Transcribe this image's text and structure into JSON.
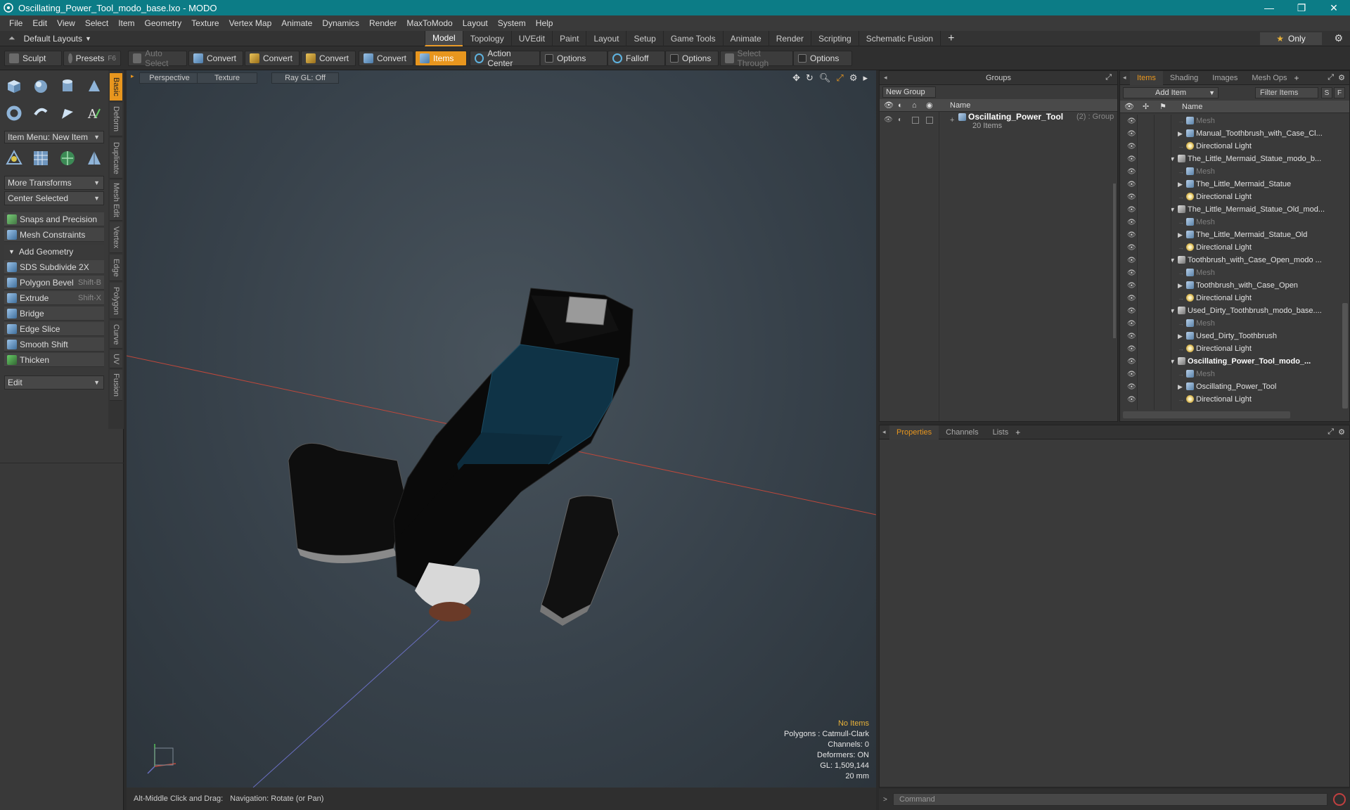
{
  "window": {
    "title": "Oscillating_Power_Tool_modo_base.lxo - MODO",
    "min": "—",
    "max": "❐",
    "close": "✕"
  },
  "menu": [
    "File",
    "Edit",
    "View",
    "Select",
    "Item",
    "Geometry",
    "Texture",
    "Vertex Map",
    "Animate",
    "Dynamics",
    "Render",
    "MaxToModo",
    "Layout",
    "System",
    "Help"
  ],
  "layoutbar": {
    "default_layouts": "Default Layouts",
    "tabs": [
      "Model",
      "Topology",
      "UVEdit",
      "Paint",
      "Layout",
      "Setup",
      "Game Tools",
      "Animate",
      "Render",
      "Scripting",
      "Schematic Fusion"
    ],
    "active_tab": "Model",
    "only": "Only"
  },
  "toolbar": {
    "sculpt": "Sculpt",
    "presets": "Presets",
    "presets_key": "F6",
    "auto_select": "Auto Select",
    "convert1": "Convert",
    "convert2": "Convert",
    "convert3": "Convert",
    "convert4": "Convert",
    "items": "Items",
    "action_center": "Action Center",
    "options1": "Options",
    "falloff": "Falloff",
    "options2": "Options",
    "select_through": "Select Through",
    "options3": "Options"
  },
  "leftpanel": {
    "vtabs": [
      "Basic",
      "Deform",
      "Duplicate",
      "Mesh Edit",
      "Vertex",
      "Edge",
      "Polygon",
      "Curve",
      "UV",
      "Fusion"
    ],
    "item_menu": "Item Menu: New Item",
    "more_transforms": "More Transforms",
    "center_selected": "Center Selected",
    "snaps": "Snaps and Precision",
    "mesh_constraints": "Mesh Constraints",
    "add_geometry": "Add Geometry",
    "tools": [
      {
        "label": "SDS Subdivide 2X",
        "key": ""
      },
      {
        "label": "Polygon Bevel",
        "key": "Shift-B"
      },
      {
        "label": "Extrude",
        "key": "Shift-X"
      },
      {
        "label": "Bridge",
        "key": ""
      },
      {
        "label": "Edge Slice",
        "key": ""
      },
      {
        "label": "Smooth Shift",
        "key": ""
      },
      {
        "label": "Thicken",
        "key": ""
      }
    ],
    "edit": "Edit"
  },
  "viewport": {
    "perspective": "Perspective",
    "texture": "Texture",
    "raygl": "Ray GL: Off",
    "info": {
      "no_items": "No Items",
      "polygons": "Polygons : Catmull-Clark",
      "channels": "Channels: 0",
      "deformers": "Deformers: ON",
      "gl": "GL: 1,509,144",
      "size": "20 mm"
    }
  },
  "statusbar": {
    "hint": "Alt-Middle Click and Drag:",
    "action": "Navigation: Rotate (or Pan)"
  },
  "groups": {
    "title": "Groups",
    "new_group": "New Group",
    "col_name": "Name",
    "group_name": "Oscillating_Power_Tool",
    "group_suffix": "(2) : Group",
    "group_items": "20 Items"
  },
  "items": {
    "tabs": [
      "Items",
      "Shading",
      "Images",
      "Mesh Ops"
    ],
    "add_item": "Add Item",
    "filter": "Filter Items",
    "s": "S",
    "f": "F",
    "col_name": "Name",
    "rows": [
      {
        "label": "Mesh",
        "type": "mesh",
        "level": 2,
        "dim": true,
        "twisty": ""
      },
      {
        "label": "Manual_Toothbrush_with_Case_Cl...",
        "type": "mesh",
        "level": 2,
        "dim": false,
        "twisty": "▶"
      },
      {
        "label": "Directional Light",
        "type": "light",
        "level": 2,
        "dim": false,
        "twisty": ""
      },
      {
        "label": "The_Little_Mermaid_Statue_modo_b...",
        "type": "scene",
        "level": 1,
        "dim": false,
        "twisty": "▼"
      },
      {
        "label": "Mesh",
        "type": "mesh",
        "level": 2,
        "dim": true,
        "twisty": ""
      },
      {
        "label": "The_Little_Mermaid_Statue",
        "type": "mesh",
        "level": 2,
        "dim": false,
        "twisty": "▶"
      },
      {
        "label": "Directional Light",
        "type": "light",
        "level": 2,
        "dim": false,
        "twisty": ""
      },
      {
        "label": "The_Little_Mermaid_Statue_Old_mod...",
        "type": "scene",
        "level": 1,
        "dim": false,
        "twisty": "▼"
      },
      {
        "label": "Mesh",
        "type": "mesh",
        "level": 2,
        "dim": true,
        "twisty": ""
      },
      {
        "label": "The_Little_Mermaid_Statue_Old",
        "type": "mesh",
        "level": 2,
        "dim": false,
        "twisty": "▶"
      },
      {
        "label": "Directional Light",
        "type": "light",
        "level": 2,
        "dim": false,
        "twisty": ""
      },
      {
        "label": "Toothbrush_with_Case_Open_modo ...",
        "type": "scene",
        "level": 1,
        "dim": false,
        "twisty": "▼"
      },
      {
        "label": "Mesh",
        "type": "mesh",
        "level": 2,
        "dim": true,
        "twisty": ""
      },
      {
        "label": "Toothbrush_with_Case_Open",
        "type": "mesh",
        "level": 2,
        "dim": false,
        "twisty": "▶"
      },
      {
        "label": "Directional Light",
        "type": "light",
        "level": 2,
        "dim": false,
        "twisty": ""
      },
      {
        "label": "Used_Dirty_Toothbrush_modo_base....",
        "type": "scene",
        "level": 1,
        "dim": false,
        "twisty": "▼"
      },
      {
        "label": "Mesh",
        "type": "mesh",
        "level": 2,
        "dim": true,
        "twisty": ""
      },
      {
        "label": "Used_Dirty_Toothbrush",
        "type": "mesh",
        "level": 2,
        "dim": false,
        "twisty": "▶"
      },
      {
        "label": "Directional Light",
        "type": "light",
        "level": 2,
        "dim": false,
        "twisty": ""
      },
      {
        "label": "Oscillating_Power_Tool_modo_...",
        "type": "scene",
        "level": 1,
        "dim": false,
        "twisty": "▼",
        "bold": true
      },
      {
        "label": "Mesh",
        "type": "mesh",
        "level": 2,
        "dim": true,
        "twisty": ""
      },
      {
        "label": "Oscillating_Power_Tool",
        "type": "mesh",
        "level": 2,
        "dim": false,
        "twisty": "▶"
      },
      {
        "label": "Directional Light",
        "type": "light",
        "level": 2,
        "dim": false,
        "twisty": ""
      }
    ]
  },
  "properties": {
    "tabs": [
      "Properties",
      "Channels",
      "Lists"
    ],
    "plus": "+"
  },
  "command": {
    "placeholder": "Command"
  },
  "colors": {
    "title_bar": "#0c7c86",
    "accent": "#e8961e",
    "x_axis": "#c0483b",
    "y_axis": "#6a6fc0"
  }
}
